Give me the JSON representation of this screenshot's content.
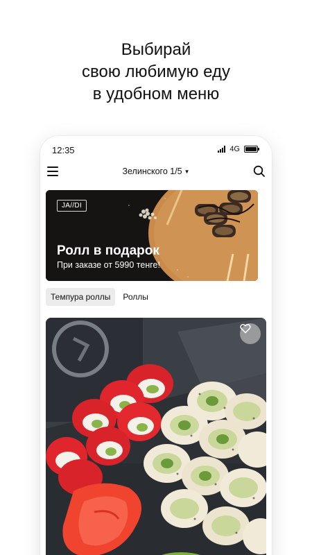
{
  "headline": {
    "line1": "Выбирай",
    "line2": "свою любимую еду",
    "line3": "в удобном меню"
  },
  "status_bar": {
    "time": "12:35",
    "network": "4G"
  },
  "app_bar": {
    "location": "Зелинского 1/5",
    "icons": [
      "menu-icon",
      "chevron-down-icon",
      "search-icon"
    ]
  },
  "banner": {
    "badge": "JA//DI",
    "title": "Ролл в подарок",
    "subtitle": "При заказе от 5990 тенге!"
  },
  "tabs": [
    {
      "label": "Темпура роллы",
      "active": true
    },
    {
      "label": "Роллы",
      "active": false
    }
  ],
  "product_card": {
    "favorite_icon": "heart-icon"
  },
  "colors": {
    "accent_dark": "#151412",
    "tab_active_bg": "#ececec",
    "text": "#111111"
  }
}
